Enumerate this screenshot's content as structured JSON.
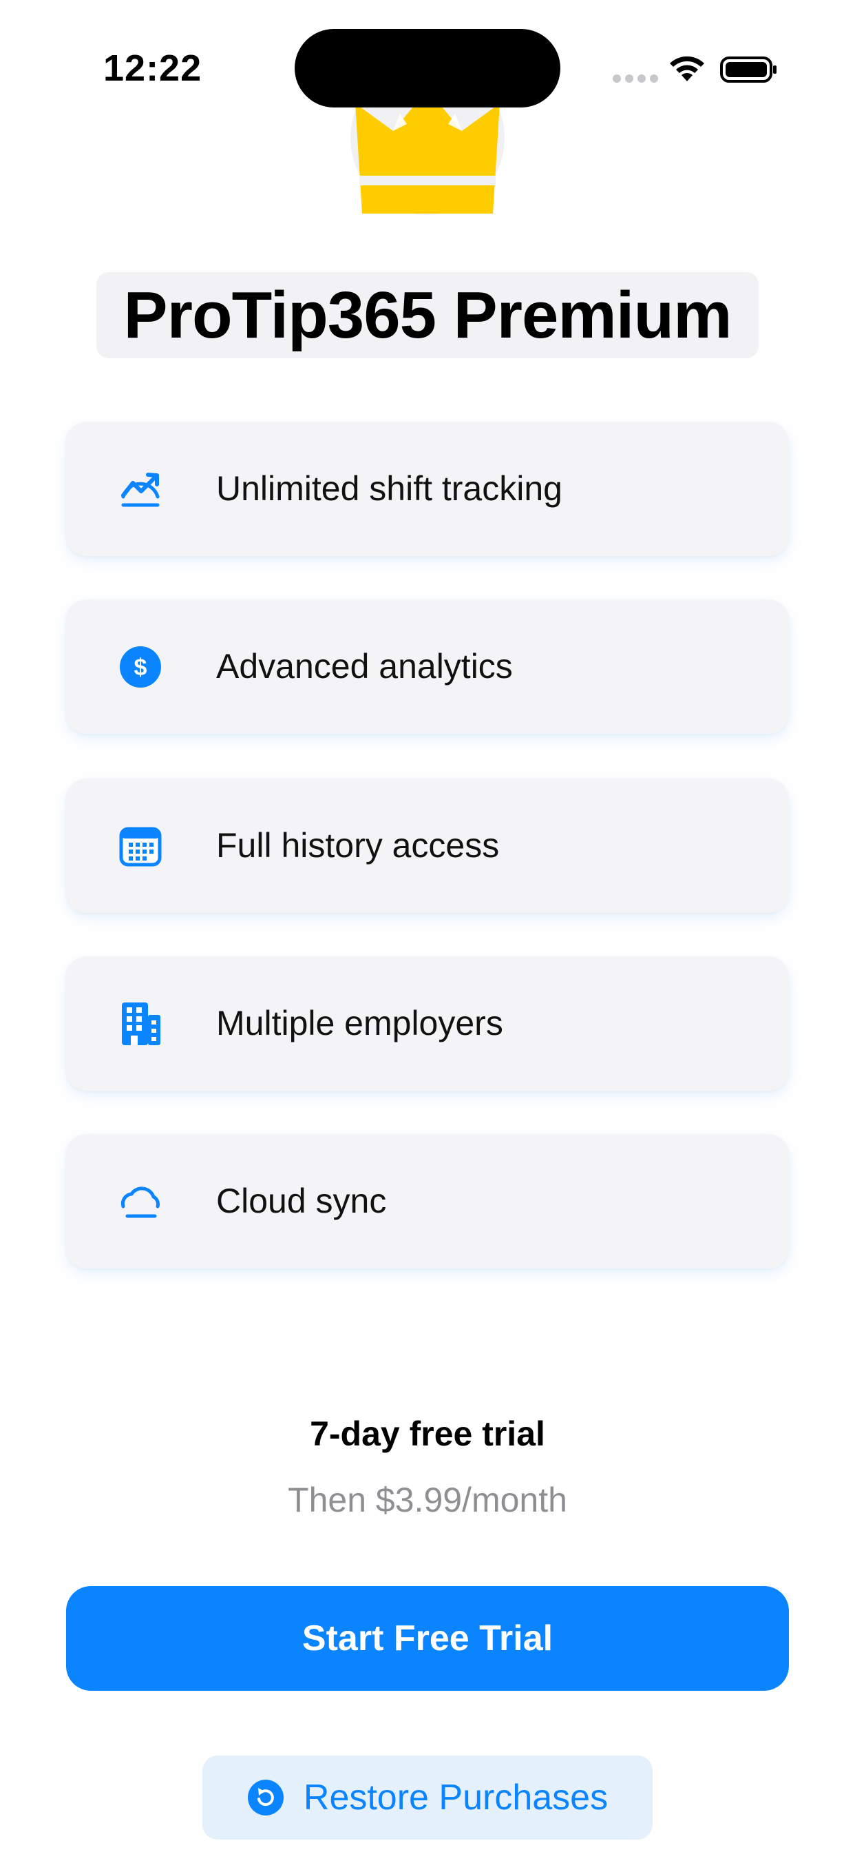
{
  "status_bar": {
    "time": "12:22"
  },
  "header": {
    "title": "ProTip365 Premium",
    "logo_icon": "crown-icon"
  },
  "features": [
    {
      "label": "Unlimited shift tracking",
      "icon": "chart-trend-icon"
    },
    {
      "label": "Advanced analytics",
      "icon": "dollar-circle-icon"
    },
    {
      "label": "Full history access",
      "icon": "calendar-icon"
    },
    {
      "label": "Multiple employers",
      "icon": "building-icon"
    },
    {
      "label": "Cloud sync",
      "icon": "cloud-icon"
    }
  ],
  "pricing": {
    "trial_label": "7-day free trial",
    "price_label": "Then $3.99/month"
  },
  "actions": {
    "start_trial_label": "Start Free Trial",
    "restore_label": "Restore Purchases"
  },
  "colors": {
    "accent": "#0a84ff",
    "crown": "#ffcc00",
    "card_background": "#f4f4f6",
    "secondary_text": "#8e8e93"
  }
}
